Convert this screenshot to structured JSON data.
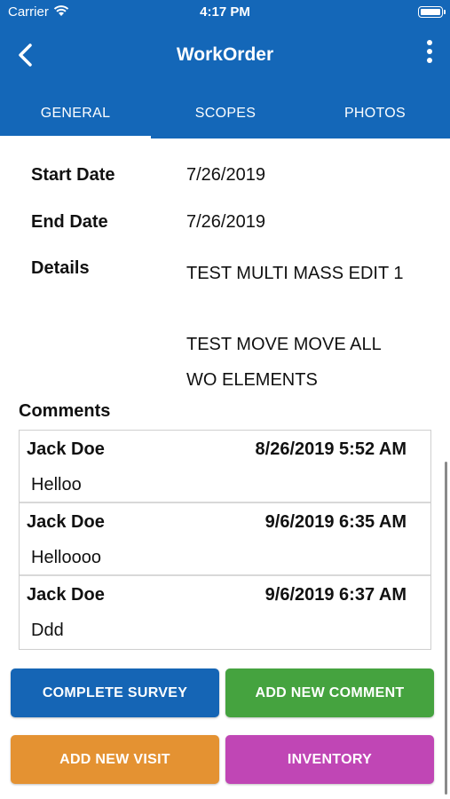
{
  "status_bar": {
    "carrier": "Carrier",
    "time": "4:17 PM"
  },
  "nav": {
    "title": "WorkOrder",
    "back_icon": "chevron-left-icon",
    "more_icon": "more-vertical-icon"
  },
  "tabs": [
    {
      "label": "GENERAL",
      "active": true
    },
    {
      "label": "SCOPES",
      "active": false
    },
    {
      "label": "PHOTOS",
      "active": false
    }
  ],
  "fields": {
    "start_date": {
      "label": "Start Date",
      "value": "7/26/2019"
    },
    "end_date": {
      "label": "End Date",
      "value": "7/26/2019"
    },
    "details": {
      "label": "Details",
      "lines": [
        "TEST MULTI MASS EDIT 1",
        "",
        "TEST MOVE MOVE ALL",
        "WO ELEMENTS"
      ]
    }
  },
  "comments": {
    "heading": "Comments",
    "items": [
      {
        "author": "Jack Doe",
        "date": "8/26/2019 5:52 AM",
        "text": "Helloo"
      },
      {
        "author": "Jack Doe",
        "date": "9/6/2019 6:35 AM",
        "text": "Helloooo"
      },
      {
        "author": "Jack Doe",
        "date": "9/6/2019 6:37 AM",
        "text": "Ddd"
      }
    ]
  },
  "buttons": {
    "complete_survey": {
      "label": "COMPLETE SURVEY",
      "color": "#1565b5"
    },
    "add_new_comment": {
      "label": "ADD NEW COMMENT",
      "color": "#45a33f"
    },
    "add_new_visit": {
      "label": "ADD NEW VISIT",
      "color": "#e49232"
    },
    "inventory": {
      "label": "INVENTORY",
      "color": "#c046b5"
    }
  },
  "colors": {
    "primary": "#1467b8"
  }
}
